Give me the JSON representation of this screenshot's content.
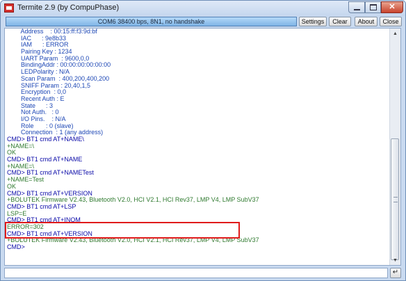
{
  "window": {
    "title": "Termite 2.9 (by CompuPhase)"
  },
  "toolbar": {
    "status": "COM6 38400 bps, 8N1, no handshake",
    "settings_label": "Settings",
    "clear_label": "Clear",
    "about_label": "About",
    "close_label": "Close"
  },
  "terminal": {
    "lines": [
      {
        "type": "info",
        "text": "        Address    : 00:15:ff:f3:9d:bf"
      },
      {
        "type": "info",
        "text": "        IAC      : 9e8b33"
      },
      {
        "type": "info",
        "text": "        IAM      : ERROR"
      },
      {
        "type": "info",
        "text": "        Pairing Key : 1234"
      },
      {
        "type": "info",
        "text": "        UART Param  : 9600,0,0"
      },
      {
        "type": "info",
        "text": "        BindingAddr : 00:00:00:00:00:00"
      },
      {
        "type": "info",
        "text": "        LEDPolarity : N/A"
      },
      {
        "type": "info",
        "text": "        Scan Param  : 400,200,400,200"
      },
      {
        "type": "info",
        "text": "        SNIFF Param : 20,40,1,5"
      },
      {
        "type": "info",
        "text": "        Encryption  : 0,0"
      },
      {
        "type": "info",
        "text": "        Recent Auth : E"
      },
      {
        "type": "info",
        "text": "        State      : 3"
      },
      {
        "type": "info",
        "text": "        Not Auth.   : 0"
      },
      {
        "type": "info",
        "text": "        I/O Pins.    : N/A"
      },
      {
        "type": "info",
        "text": "        Role       : 0 (slave)"
      },
      {
        "type": "info",
        "text": "        Connection  : 1 (any address)"
      },
      {
        "type": "out",
        "text": "CMD> BT1 cmd AT+NAME\\"
      },
      {
        "type": "in",
        "text": "+NAME=\\"
      },
      {
        "type": "in",
        "text": "OK"
      },
      {
        "type": "out",
        "text": "CMD> BT1 cmd AT+NAME"
      },
      {
        "type": "in",
        "text": "+NAME=\\"
      },
      {
        "type": "out",
        "text": "CMD> BT1 cmd AT+NAMETest"
      },
      {
        "type": "in",
        "text": "+NAME=Test"
      },
      {
        "type": "in",
        "text": "OK"
      },
      {
        "type": "out",
        "text": "CMD> BT1 cmd AT+VERSION"
      },
      {
        "type": "in",
        "text": "+BOLUTEK Firmware V2.43, Bluetooth V2.0, HCI V2.1, HCI Rev37, LMP V4, LMP SubV37"
      },
      {
        "type": "out",
        "text": "CMD> BT1 cmd AT+LSP"
      },
      {
        "type": "in",
        "text": "LSP=E"
      },
      {
        "type": "out",
        "text": "CMD> BT1 cmd AT+INQM"
      },
      {
        "type": "in",
        "text": "ERROR=302"
      },
      {
        "type": "out",
        "text": "CMD> BT1 cmd AT+VERSION"
      },
      {
        "type": "in",
        "text": "+BOLUTEK Firmware V2.43, Bluetooth V2.0, HCI V2.1, HCI Rev37, LMP V4, LMP SubV37"
      },
      {
        "type": "out",
        "text": "CMD>"
      }
    ]
  },
  "input": {
    "value": "",
    "send_glyph": "↵"
  },
  "icons": {
    "app": "termite-app-icon",
    "minimize": "minimize-icon",
    "maximize": "maximize-icon",
    "close": "close-icon",
    "scroll_up": "scroll-up-arrow-icon",
    "scroll_down": "scroll-down-arrow-icon",
    "send": "enter-icon"
  },
  "colors": {
    "command_text": "#0a0aa8",
    "response_text": "#2f7a2f",
    "highlight_border": "#e01b1b",
    "status_bar": "#8fc0ec"
  }
}
